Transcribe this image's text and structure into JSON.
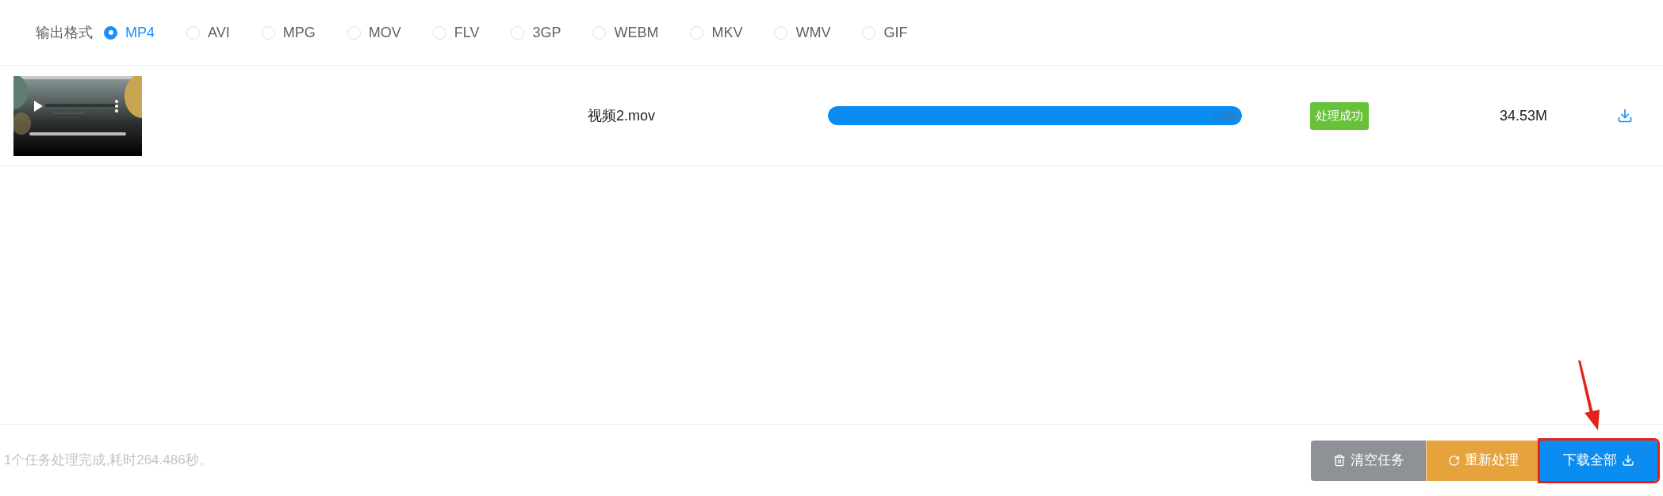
{
  "output_format": {
    "label": "输出格式",
    "options": [
      {
        "label": "MP4",
        "selected": true
      },
      {
        "label": "AVI",
        "selected": false
      },
      {
        "label": "MPG",
        "selected": false
      },
      {
        "label": "MOV",
        "selected": false
      },
      {
        "label": "FLV",
        "selected": false
      },
      {
        "label": "3GP",
        "selected": false
      },
      {
        "label": "WEBM",
        "selected": false
      },
      {
        "label": "MKV",
        "selected": false
      },
      {
        "label": "WMV",
        "selected": false
      },
      {
        "label": "GIF",
        "selected": false
      }
    ]
  },
  "tasks": [
    {
      "filename": "视频2.mov",
      "level": 1,
      "progress_text": "100%",
      "status": "处理成功",
      "size": "34.53M"
    }
  ],
  "status_bar": {
    "message": "1个任务处理完成,耗时264.486秒。",
    "buttons": [
      {
        "kind": "clear",
        "label": "清空任务",
        "highlighted": false
      },
      {
        "kind": "redo",
        "label": "重新处理",
        "highlighted": false
      },
      {
        "kind": "download",
        "label": "下载全部",
        "highlighted": true
      }
    ]
  }
}
